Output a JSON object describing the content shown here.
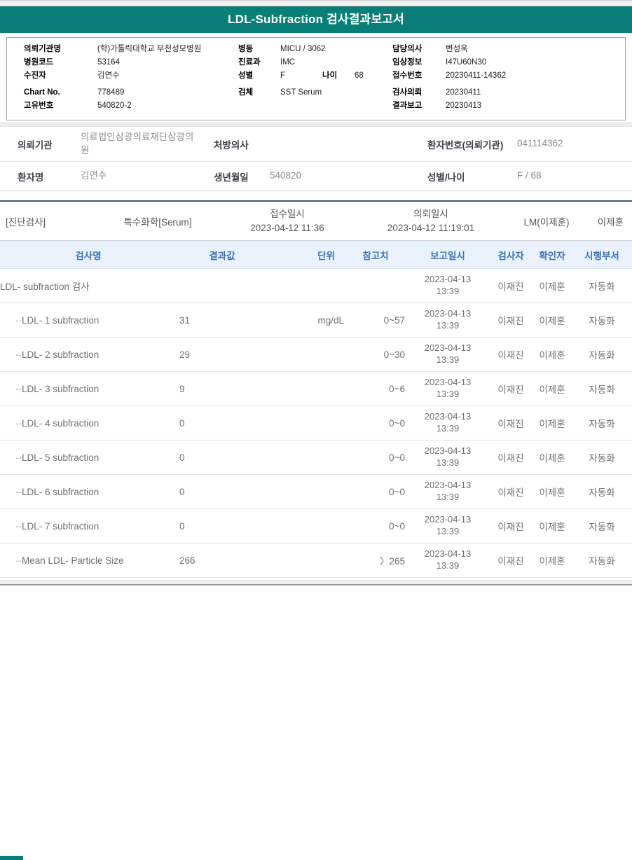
{
  "title": "LDL-Subfraction 검사결과보고서",
  "accent_colors": {
    "teal": "#087f76",
    "table_header_text": "#3e74b4",
    "table_header_bg": "#e9f2fa"
  },
  "info": {
    "left": [
      {
        "label": "의뢰기관명",
        "value": "(학)가톨릭대학교 부천성모병원"
      },
      {
        "label": "병원코드",
        "value": "53164"
      },
      {
        "label": "수진자",
        "value": "김연수"
      },
      {
        "label": "Chart No.",
        "value": "778489"
      },
      {
        "label": "고유번호",
        "value": "540820-2"
      }
    ],
    "middle": [
      {
        "label": "병동",
        "value": "MICU / 3062"
      },
      {
        "label": "진료과",
        "value": "IMC"
      },
      {
        "label": "성별",
        "value": "F",
        "label2": "나이",
        "value2": "68"
      },
      {
        "label": "검체",
        "value": "SST Serum"
      }
    ],
    "right": [
      {
        "label": "담당의사",
        "value": "변성욱"
      },
      {
        "label": "임상정보",
        "value": "I47U60N30"
      },
      {
        "label": "접수번호",
        "value": "20230411-14362"
      },
      {
        "label": "검사의뢰",
        "value": "20230411"
      },
      {
        "label": "결과보고",
        "value": "20230413"
      }
    ]
  },
  "patient": {
    "row1": [
      {
        "label": "의뢰기관",
        "value": "의료법인삼광의료재단삼광의원"
      },
      {
        "label": "처방의사",
        "value": ""
      },
      {
        "label": "환자번호(의뢰기관)",
        "value": "041114362"
      }
    ],
    "row2": [
      {
        "label": "환자명",
        "value": "김연수"
      },
      {
        "label": "생년월일",
        "value": "540820"
      },
      {
        "label": "성별/나이",
        "value": "F / 68"
      }
    ]
  },
  "section": {
    "dept": "[진단검사]",
    "category": "특수화학[Serum]",
    "receipt_label": "접수일시",
    "receipt_value": "2023-04-12 11:36",
    "request_label": "의뢰일시",
    "request_value": "2023-04-12 11:19:01",
    "lm": "LM(이제훈)",
    "signer": "이제훈"
  },
  "results_table": {
    "columns": [
      "검사명",
      "결과값",
      "단위",
      "참고치",
      "보고일시",
      "검사자",
      "확인자",
      "시행부서"
    ],
    "rows": [
      {
        "name": "LDL- subfraction 검사",
        "result": "",
        "unit": "",
        "ref": "",
        "date": "2023-04-13",
        "time": "13:39",
        "tester": "이재진",
        "verifier": "이제훈",
        "dept": "자동화",
        "parent": true
      },
      {
        "name": "··LDL- 1 subfraction",
        "result": "31",
        "unit": "mg/dL",
        "ref": "0~57",
        "date": "2023-04-13",
        "time": "13:39",
        "tester": "이재진",
        "verifier": "이제훈",
        "dept": "자동화"
      },
      {
        "name": "··LDL- 2 subfraction",
        "result": "29",
        "unit": "",
        "ref": "0~30",
        "date": "2023-04-13",
        "time": "13:39",
        "tester": "이재진",
        "verifier": "이제훈",
        "dept": "자동화"
      },
      {
        "name": "··LDL- 3 subfraction",
        "result": "9",
        "unit": "",
        "ref": "0~6",
        "date": "2023-04-13",
        "time": "13:39",
        "tester": "이재진",
        "verifier": "이제훈",
        "dept": "자동화"
      },
      {
        "name": "··LDL- 4 subfraction",
        "result": "0",
        "unit": "",
        "ref": "0~0",
        "date": "2023-04-13",
        "time": "13:39",
        "tester": "이재진",
        "verifier": "이제훈",
        "dept": "자동화"
      },
      {
        "name": "··LDL- 5 subfraction",
        "result": "0",
        "unit": "",
        "ref": "0~0",
        "date": "2023-04-13",
        "time": "13:39",
        "tester": "이재진",
        "verifier": "이제훈",
        "dept": "자동화"
      },
      {
        "name": "··LDL- 6 subfraction",
        "result": "0",
        "unit": "",
        "ref": "0~0",
        "date": "2023-04-13",
        "time": "13:39",
        "tester": "이재진",
        "verifier": "이제훈",
        "dept": "자동화"
      },
      {
        "name": "··LDL- 7 subfraction",
        "result": "0",
        "unit": "",
        "ref": "0~0",
        "date": "2023-04-13",
        "time": "13:39",
        "tester": "이재진",
        "verifier": "이제훈",
        "dept": "자동화"
      },
      {
        "name": "··Mean LDL- Particle Size",
        "result": "266",
        "unit": "",
        "ref": "〉265",
        "date": "2023-04-13",
        "time": "13:39",
        "tester": "이재진",
        "verifier": "이제훈",
        "dept": "자동화"
      }
    ]
  }
}
